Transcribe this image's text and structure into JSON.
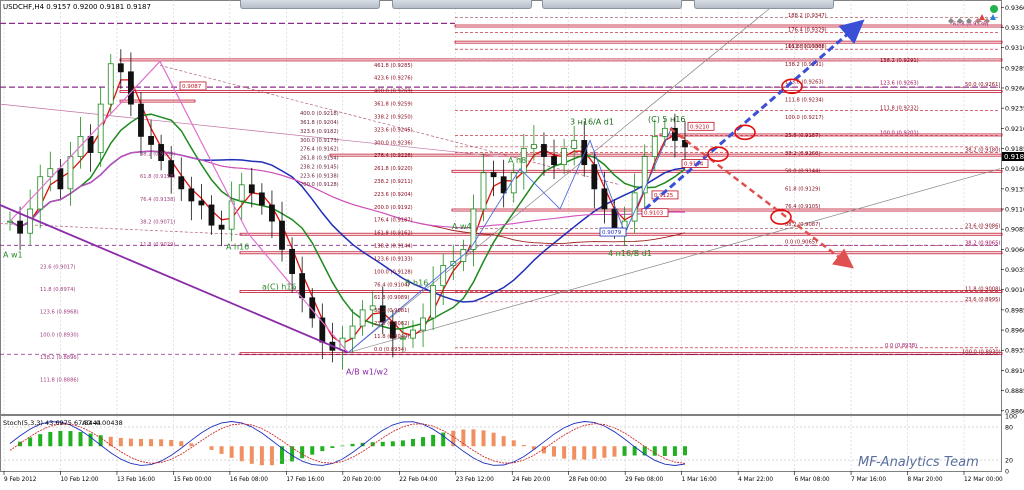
{
  "window": {
    "symbol_line": "USDCHF,H4 0.9157 0.9200 0.9181 0.9187",
    "current_price": "0.9187",
    "watermark": "MF-Analytics Team"
  },
  "indicator": {
    "label": "Stoch(5,3,3) 43.6975 67.5444",
    "label2": "AO -0.00438"
  },
  "colors": {
    "bull": "#1e8a1e",
    "bear": "#d01010",
    "level": "#c0102a",
    "fib": "#8a1020",
    "forecast_up": "#3a4fd6",
    "forecast_down": "#e05050",
    "wave": "#8b2ba8"
  },
  "chart_data": {
    "type": "candlestick",
    "title": "USDCHF,H4",
    "ylim": [
      0.8856,
      0.9369
    ],
    "price_ticks": [
      "0.9360",
      "0.9335",
      "0.9310",
      "0.9285",
      "0.9260",
      "0.9235",
      "0.9210",
      "0.9185",
      "0.9160",
      "0.9135",
      "0.9110",
      "0.9085",
      "0.9060",
      "0.9035",
      "0.9010",
      "0.8985",
      "0.8960",
      "0.8935",
      "0.8910",
      "0.8885",
      "0.8860"
    ],
    "indicator_ticks": [
      "100",
      "80",
      "20",
      "0"
    ],
    "time_ticks": [
      "9 Feb 2012",
      "10 Feb 12:00",
      "13 Feb 16:00",
      "15 Feb 00:00",
      "16 Feb 08:00",
      "17 Feb 16:00",
      "20 Feb 20:00",
      "22 Feb 04:00",
      "23 Feb 12:00",
      "24 Feb 20:00",
      "28 Feb 00:00",
      "29 Feb 08:00",
      "1 Mar 16:00",
      "4 Mar 22:00",
      "6 Mar 08:00",
      "7 Mar 16:00",
      "8 Mar 20:00",
      "12 Mar 00:00"
    ],
    "path": [
      0.9095,
      0.908,
      0.911,
      0.915,
      0.916,
      0.9135,
      0.9175,
      0.92,
      0.918,
      0.924,
      0.929,
      0.928,
      0.924,
      0.92,
      0.919,
      0.917,
      0.915,
      0.9135,
      0.912,
      0.9115,
      0.909,
      0.9085,
      0.912,
      0.914,
      0.913,
      0.9115,
      0.9095,
      0.906,
      0.903,
      0.9,
      0.8975,
      0.8945,
      0.8935,
      0.895,
      0.8965,
      0.8985,
      0.899,
      0.897,
      0.895,
      0.895,
      0.896,
      0.8975,
      0.9015,
      0.904,
      0.9045,
      0.906,
      0.911,
      0.9155,
      0.915,
      0.913,
      0.9155,
      0.9185,
      0.919,
      0.9175,
      0.9165,
      0.9185,
      0.9195,
      0.9165,
      0.9135,
      0.911,
      0.9085,
      0.9095,
      0.913,
      0.9175,
      0.92,
      0.921,
      0.9195,
      0.9187
    ],
    "annotations": {
      "waves": [
        "A w1",
        "A h16",
        "a(C) h16",
        "A/B w1/w2",
        "A w4",
        "A h8",
        "B h16",
        "3 н16/A d1",
        "(C) 5 н16",
        "4 н16/B d1"
      ],
      "levels_right": [
        "188.2 (0.9347)",
        "176.4 (0.9329)",
        "61.8 (0.9336)",
        "161.8 (0.9308)",
        "138.2 (0.9291)",
        "123.6 (0.9263)",
        "50.0 (0.9261)",
        "111.8 (0.9232)",
        "100.0 (0.9201)",
        "38.2 (0.9180)",
        "23.6 (0.9086)",
        "38.2 (0.9065)",
        "11.8 (0.9008)",
        "23.6 (0.8995)",
        "0.0 (0.8938)",
        "100.0 (0.8930)"
      ],
      "levels_center": [
        "461.8 (0.9285)",
        "423.6 (0.9276)",
        "400.0 (0.9269)",
        "361.8 (0.9259)",
        "338.2 (0.9250)",
        "323.6 (0.9245)",
        "300.0 (0.9236)",
        "276.4 (0.9226)",
        "261.8 (0.9220)",
        "238.2 (0.9211)",
        "223.6 (0.9204)",
        "200.0 (0.9192)",
        "176.4 (0.9187)",
        "161.8 (0.9162)",
        "138.2 (0.9144)",
        "123.6 (0.9133)",
        "100.0 (0.9128)",
        "76.4 (0.9104)",
        "61.8 (0.9089)",
        "38.2 (0.9081)",
        "23.6 (0.9062)",
        "11.8 (0.9040)",
        "0.0 (0.8934)"
      ],
      "levels_mid": [
        "400.0 (0.9218)",
        "361.8 (0.9204)",
        "323.6 (0.9182)",
        "300.0 (0.9173)",
        "276.4 (0.9162)",
        "261.8 (0.9154)",
        "238.2 (0.9145)",
        "223.6 (0.9138)",
        "200.0 (0.9128)"
      ],
      "levels_right2": [
        "161.8 (0.9308)",
        "138.2 (0.9291)",
        "123.6 (0.9263)",
        "111.8 (0.9234)",
        "100.0 (0.9217)",
        "23.6 (0.9187)",
        "38.2 (0.9160)",
        "50.0 (0.9144)",
        "61.8 (0.9129)",
        "76.4 (0.9105)",
        "88.2 (0.9087)",
        "0.0 (0.9065)"
      ],
      "levels_left": [
        "38.2 (0.9089)",
        "61.8 (0.9158)",
        "76.4 (0.9138)",
        "38.2 (0.9071)",
        "11.8 (0.9029)",
        "23.6 (0.9017)",
        "11.8 (0.8974)",
        "123.6 (0.8968)",
        "100.0 (0.8930)",
        "138.2 (0.8896)",
        "111.8 (0.8886)"
      ],
      "boxes": [
        "0.9079",
        "0.9125",
        "0.9164",
        "0.9210",
        "0.9103",
        "0.9087"
      ]
    }
  }
}
